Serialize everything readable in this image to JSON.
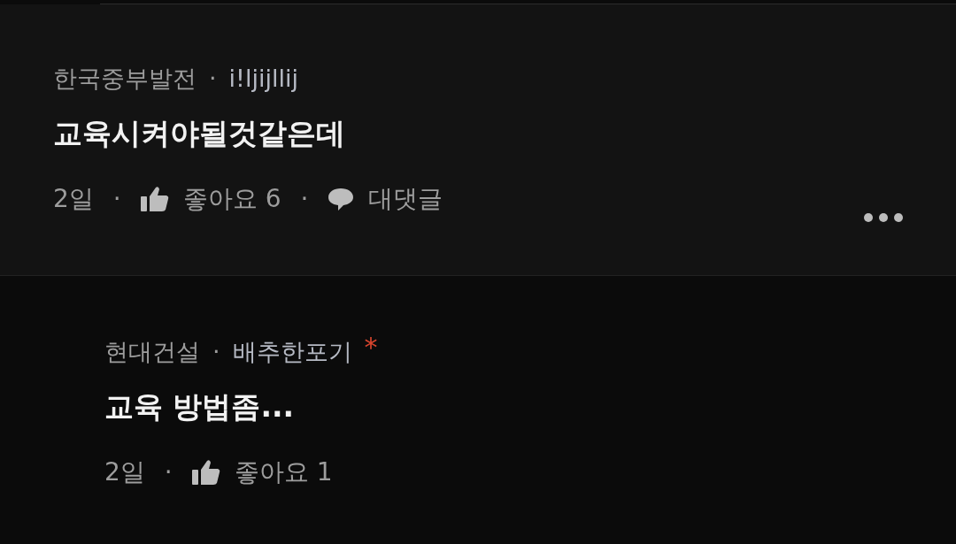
{
  "comments": [
    {
      "is_reply": false,
      "company": "한국중부발전",
      "name_dot": "·",
      "nickname": "i!ljijllij",
      "text": "교육시켜야될것같은데",
      "more_menu": true,
      "meta": [
        {
          "kind": "time",
          "text": "2일"
        },
        {
          "kind": "dot",
          "text": "·"
        },
        {
          "kind": "like",
          "text": "좋아요 6"
        },
        {
          "kind": "dot",
          "text": "·"
        },
        {
          "kind": "reply",
          "text": "대댓글"
        }
      ]
    },
    {
      "is_reply": true,
      "company": "현대건설",
      "name_dot": "·",
      "nickname": "배추한포기",
      "new_mark": "*",
      "text": "교육 방법좀...",
      "more_menu": false,
      "meta": [
        {
          "kind": "time",
          "text": "2일"
        },
        {
          "kind": "dot",
          "text": "·"
        },
        {
          "kind": "like",
          "text": "좋아요 1"
        }
      ]
    }
  ]
}
